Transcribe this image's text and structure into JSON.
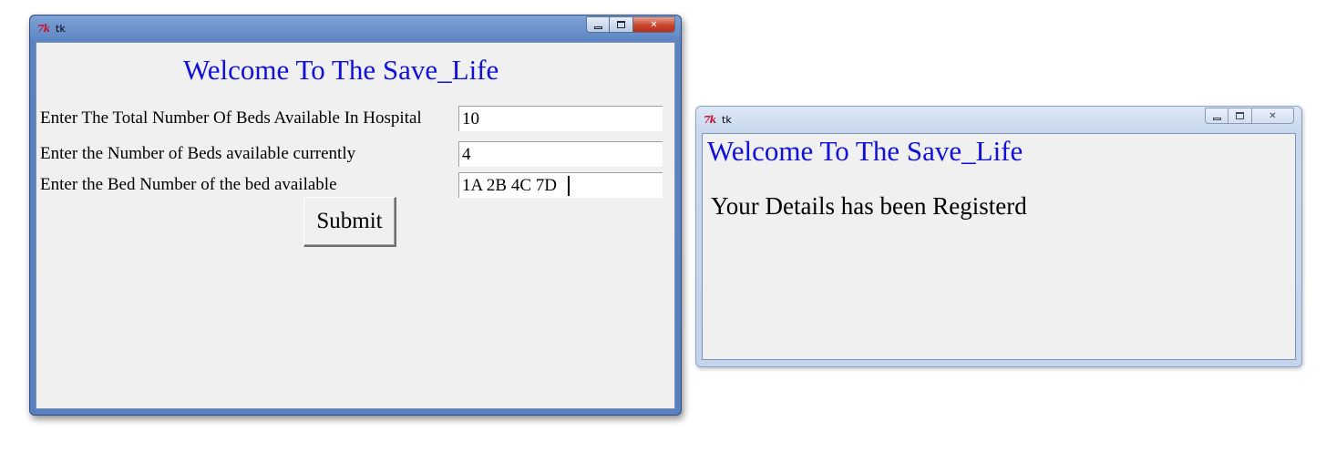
{
  "form_window": {
    "title": "tk",
    "logo_text": "7k",
    "heading": "Welcome To The Save_Life",
    "fields": [
      {
        "label": "Enter The Total Number Of Beds Available In Hospital",
        "value": "10"
      },
      {
        "label": "Enter the Number of Beds available currently",
        "value": "4"
      },
      {
        "label": "Enter the Bed Number of the bed available",
        "value": "1A 2B 4C 7D"
      }
    ],
    "submit_label": "Submit",
    "close_glyph": "✕"
  },
  "result_window": {
    "title": "tk",
    "logo_text": "7k",
    "heading": "Welcome To The Save_Life",
    "message": "Your Details has been Registerd",
    "close_glyph": "✕"
  },
  "colors": {
    "heading": "#1010d8",
    "client_bg": "#f0f0f0",
    "active_frame": "#5b83c2",
    "inactive_frame": "#c8d8ee",
    "close_button": "#c7442a"
  },
  "icons": [
    "tk-feather-icon",
    "minimize-icon",
    "maximize-icon",
    "close-icon"
  ]
}
